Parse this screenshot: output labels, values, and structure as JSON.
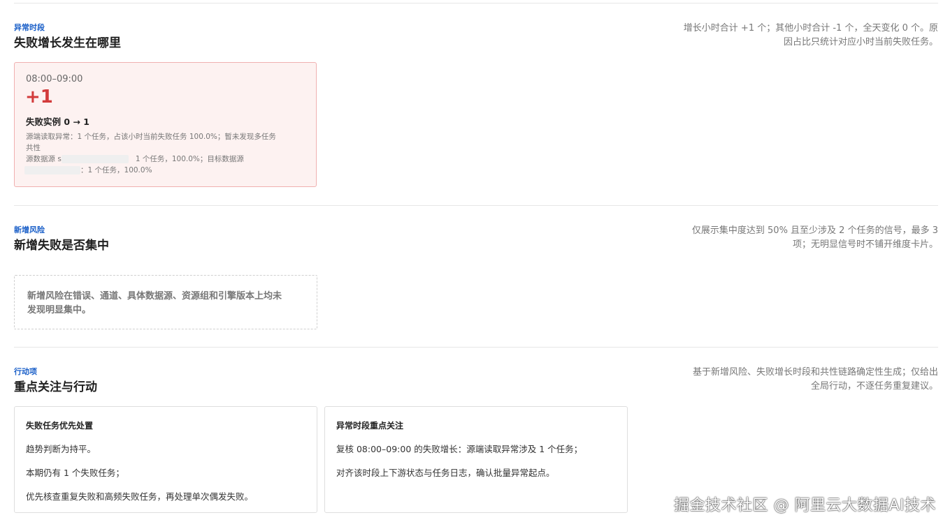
{
  "sections": {
    "anomaly": {
      "tag": "异常时段",
      "title": "失败增长发生在哪里",
      "note_line1": "增长小时合计 +1 个；其他小时合计 -1 个，全天变化 0 个。原",
      "note_line2": "因占比只统计对应小时当前失败任务。",
      "card": {
        "range": "08:00–09:00",
        "delta": "+1",
        "instances": "失败实例 0 → 1",
        "line1": "源端读取异常：1 个任务，占该小时当前失败任务 100.0%；暂未发现多任务",
        "line2": "共性",
        "line3_prefix": "源数据源 s",
        "line3_suffix": "1 个任务，100.0%；目标数据源",
        "line4_suffix": "：1 个任务，100.0%"
      }
    },
    "risk": {
      "tag": "新增风险",
      "title": "新增失败是否集中",
      "note_line1": "仅展示集中度达到 50% 且至少涉及 2 个任务的信号，最多 3",
      "note_line2": "项；无明显信号时不铺开维度卡片。",
      "empty_line1": "新增风险在错误、通道、具体数据源、资源组和引擎版本上均未",
      "empty_line2": "发现明显集中。"
    },
    "actions": {
      "tag": "行动项",
      "title": "重点关注与行动",
      "note_line1": "基于新增风险、失败增长时段和共性链路确定性生成；仅给出",
      "note_line2": "全局行动，不逐任务重复建议。",
      "cards": [
        {
          "title": "失败任务优先处置",
          "items": [
            "趋势判断为持平。",
            "本期仍有 1 个失败任务；",
            "优先核查重复失败和高频失败任务，再处理单次偶发失败。"
          ]
        },
        {
          "title": "异常时段重点关注",
          "items": [
            "复核 08:00–09:00 的失败增长：源端读取异常涉及 1 个任务；",
            "对齐该时段上下游状态与任务日志，确认批量异常起点。"
          ]
        }
      ]
    }
  },
  "watermark": "掘金技术社区 @ 阿里云大数据AI技术",
  "colors": {
    "accent": "#1a5fc8",
    "danger": "#d23b3b",
    "card_bg": "#fdf2f1",
    "card_border": "#f0b0b0"
  }
}
